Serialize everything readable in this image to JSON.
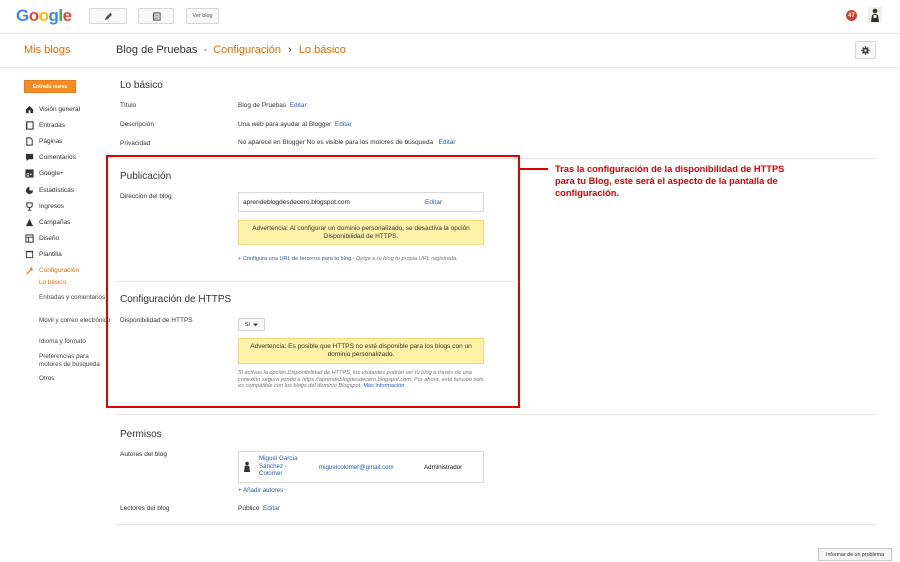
{
  "topbar": {
    "logo": [
      "G",
      "o",
      "o",
      "g",
      "l",
      "e"
    ],
    "logo_colors": [
      "#4285f4",
      "#ea4335",
      "#fbbc05",
      "#4285f4",
      "#34a853",
      "#ea4335"
    ],
    "view_blog": "Ver blog",
    "notification_count": "47"
  },
  "header": {
    "my_blogs": "Mis blogs",
    "blog_name": "Blog de Pruebas",
    "sep1": "·",
    "section": "Configuración",
    "sep2": "›",
    "page": "Lo básico"
  },
  "sidebar": {
    "new_post": "Entrada nueva",
    "items": [
      {
        "label": "Visión general",
        "icon": "home-icon"
      },
      {
        "label": "Entradas",
        "icon": "posts-icon"
      },
      {
        "label": "Páginas",
        "icon": "pages-icon"
      },
      {
        "label": "Comentarios",
        "icon": "comments-icon"
      },
      {
        "label": "Google+",
        "icon": "google-plus-icon"
      },
      {
        "label": "Estadísticas",
        "icon": "stats-icon"
      },
      {
        "label": "Ingresos",
        "icon": "trophy-icon"
      },
      {
        "label": "Campañas",
        "icon": "campaigns-icon"
      },
      {
        "label": "Diseño",
        "icon": "layout-icon"
      },
      {
        "label": "Plantilla",
        "icon": "template-icon"
      },
      {
        "label": "Configuración",
        "icon": "wrench-icon"
      }
    ],
    "sub": [
      "Lo básico",
      "Entradas y comentarios",
      "Móvil y correo electrónico",
      "Idioma y formato",
      "Preferencias para motores de búsqueda",
      "Otros"
    ],
    "accent": "#e66b00"
  },
  "basics": {
    "title": "Lo básico",
    "rows": [
      {
        "label": "Título",
        "value": "Blog de Pruebas",
        "action": "Editar"
      },
      {
        "label": "Descripción",
        "value": "Una web para ayudar al Blogger",
        "action": "Editar"
      },
      {
        "label": "Privacidad",
        "value": "No aparece en Blogger No es visible para los motores de búsqueda",
        "action": "Editar"
      }
    ]
  },
  "publication": {
    "title": "Publicación",
    "address_label": "Dirección del blog",
    "address_value": "aprendeblogdesdecero.blogspot.com",
    "address_edit": "Editar",
    "warning": "Advertencia: Al configurar un dominio personalizado, se desactiva la opción Disponibilidad de HTTPS.",
    "third_party_link": "+ Configura una URL de terceros para tu blog",
    "third_party_note": " - Dirige a tu blog tu propia URL registrada."
  },
  "https": {
    "title": "Configuración de HTTPS",
    "label": "Disponibilidad de HTTPS",
    "select_value": "Sí",
    "warning": "Advertencia: Es posible que HTTPS no esté disponible para los blogs con un dominio personalizado.",
    "note": "Si activas la opción Disponibilidad de HTTPS, los visitantes podrán ver tu blog a través de una conexión segura yendo a https://aprendeblogdesdecero.blogspot.com. Por ahora, esta función solo es compatible con los blogs del dominio Blogspot.",
    "more_info": "Más información"
  },
  "annotation": {
    "text": "Tras la configuración de la disponibilidad de HTTPS para tu Blog, este será el aspecto de la pantalla de configuración.",
    "color": "#e00000"
  },
  "permissions": {
    "title": "Permisos",
    "authors_label": "Autores del blog",
    "author_name": "Miguel García Sánchez - Colomer",
    "author_email": "miguelcolomer@gmail.com",
    "author_role": "Administrador",
    "add_authors": "+ Añadir autores",
    "readers_label": "Lectores del blog",
    "readers_value": "Público",
    "readers_edit": "Editar"
  },
  "report": "Informar de un problema"
}
